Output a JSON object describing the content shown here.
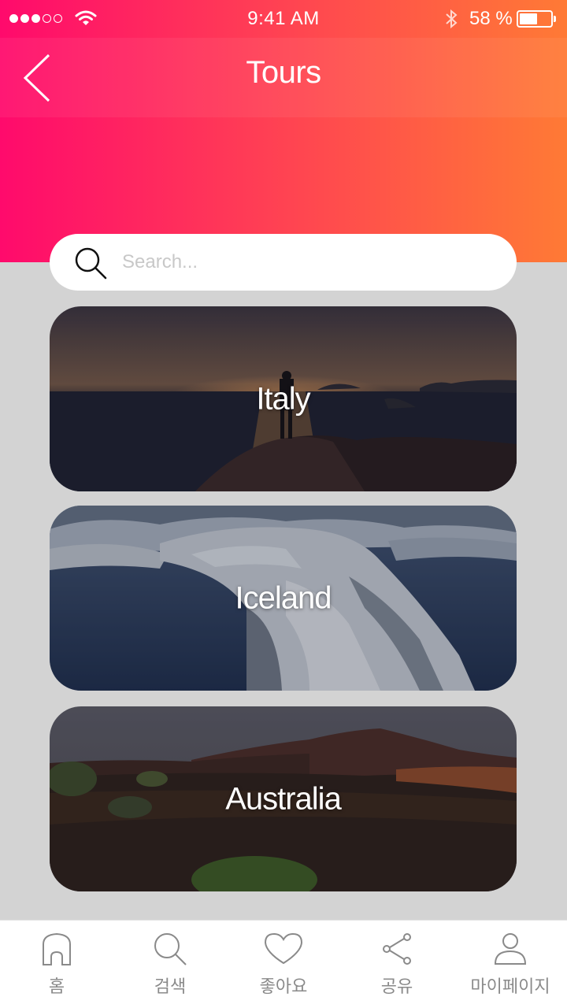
{
  "status_bar": {
    "time": "9:41 AM",
    "battery_percent": "58 %",
    "battery_level": 0.58,
    "icons": [
      "signal-dots-icon",
      "wifi-icon",
      "bluetooth-icon",
      "battery-icon"
    ]
  },
  "header": {
    "title": "Tours",
    "back_icon": "chevron-left-icon",
    "gradient": [
      "#ff0a6c",
      "#ff3d55",
      "#ff7a35"
    ]
  },
  "search": {
    "placeholder": "Search...",
    "value": "",
    "icon": "search-icon"
  },
  "tours": [
    {
      "name": "Italy"
    },
    {
      "name": "Iceland"
    },
    {
      "name": "Australia"
    }
  ],
  "tab_bar": {
    "items": [
      {
        "label": "홈",
        "icon": "home-icon"
      },
      {
        "label": "검색",
        "icon": "search-icon"
      },
      {
        "label": "좋아요",
        "icon": "heart-icon"
      },
      {
        "label": "공유",
        "icon": "share-icon"
      },
      {
        "label": "마이페이지",
        "icon": "user-icon"
      }
    ]
  },
  "colors": {
    "page_background": "#d3d3d3",
    "tab_label": "#8a8a8a",
    "placeholder": "#c8c8c8"
  }
}
